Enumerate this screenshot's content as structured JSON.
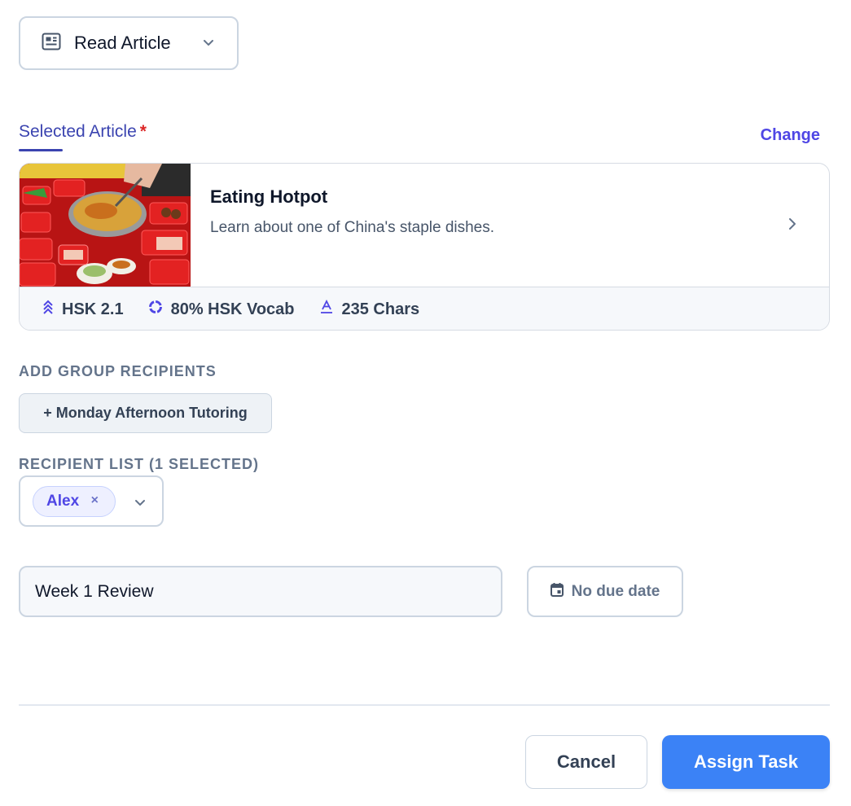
{
  "task_type": {
    "label": "Read Article",
    "icon": "article-icon"
  },
  "selected_article": {
    "section_label": "Selected Article",
    "required_mark": "*",
    "change_label": "Change",
    "title": "Eating Hotpot",
    "description": "Learn about one of China's staple dishes.",
    "meta": [
      {
        "icon": "level-chevrons-icon",
        "text": "HSK 2.1"
      },
      {
        "icon": "vocab-ring-icon",
        "text": "80% HSK Vocab"
      },
      {
        "icon": "characters-icon",
        "text": "235 Chars"
      }
    ]
  },
  "group_recipients": {
    "label": "ADD GROUP RECIPIENTS",
    "chips": [
      "+ Monday Afternoon Tutoring"
    ]
  },
  "recipient_list": {
    "label": "RECIPIENT LIST (1 SELECTED)",
    "selected": [
      "Alex"
    ],
    "remove_glyph": "×"
  },
  "task_title": {
    "value": "Week 1 Review"
  },
  "due_date": {
    "label": "No due date",
    "icon": "calendar-icon"
  },
  "actions": {
    "cancel": "Cancel",
    "assign": "Assign Task"
  },
  "colors": {
    "accent": "#4f46e5",
    "primary_button": "#3b82f6",
    "required": "#dc2626",
    "border": "#cbd5e1"
  }
}
